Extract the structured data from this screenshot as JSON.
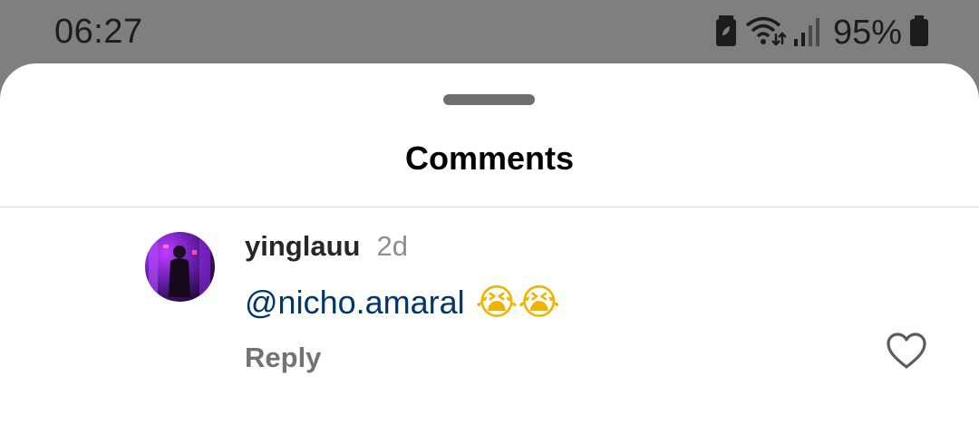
{
  "status_bar": {
    "time": "06:27",
    "battery_percent": "95%",
    "icons": [
      "battery-saver-icon",
      "wifi-icon",
      "signal-icon",
      "battery-icon"
    ]
  },
  "sheet": {
    "title": "Comments"
  },
  "comment": {
    "username": "yinglauu",
    "time_ago": "2d",
    "mention": "@nicho.amaral",
    "emojis": "😭😭",
    "reply_label": "Reply",
    "like_icon": "heart-outline-icon"
  },
  "colors": {
    "status_bar_bg": "#7f7f7f",
    "mention": "#00376b",
    "secondary_text": "#8e8e8e"
  }
}
